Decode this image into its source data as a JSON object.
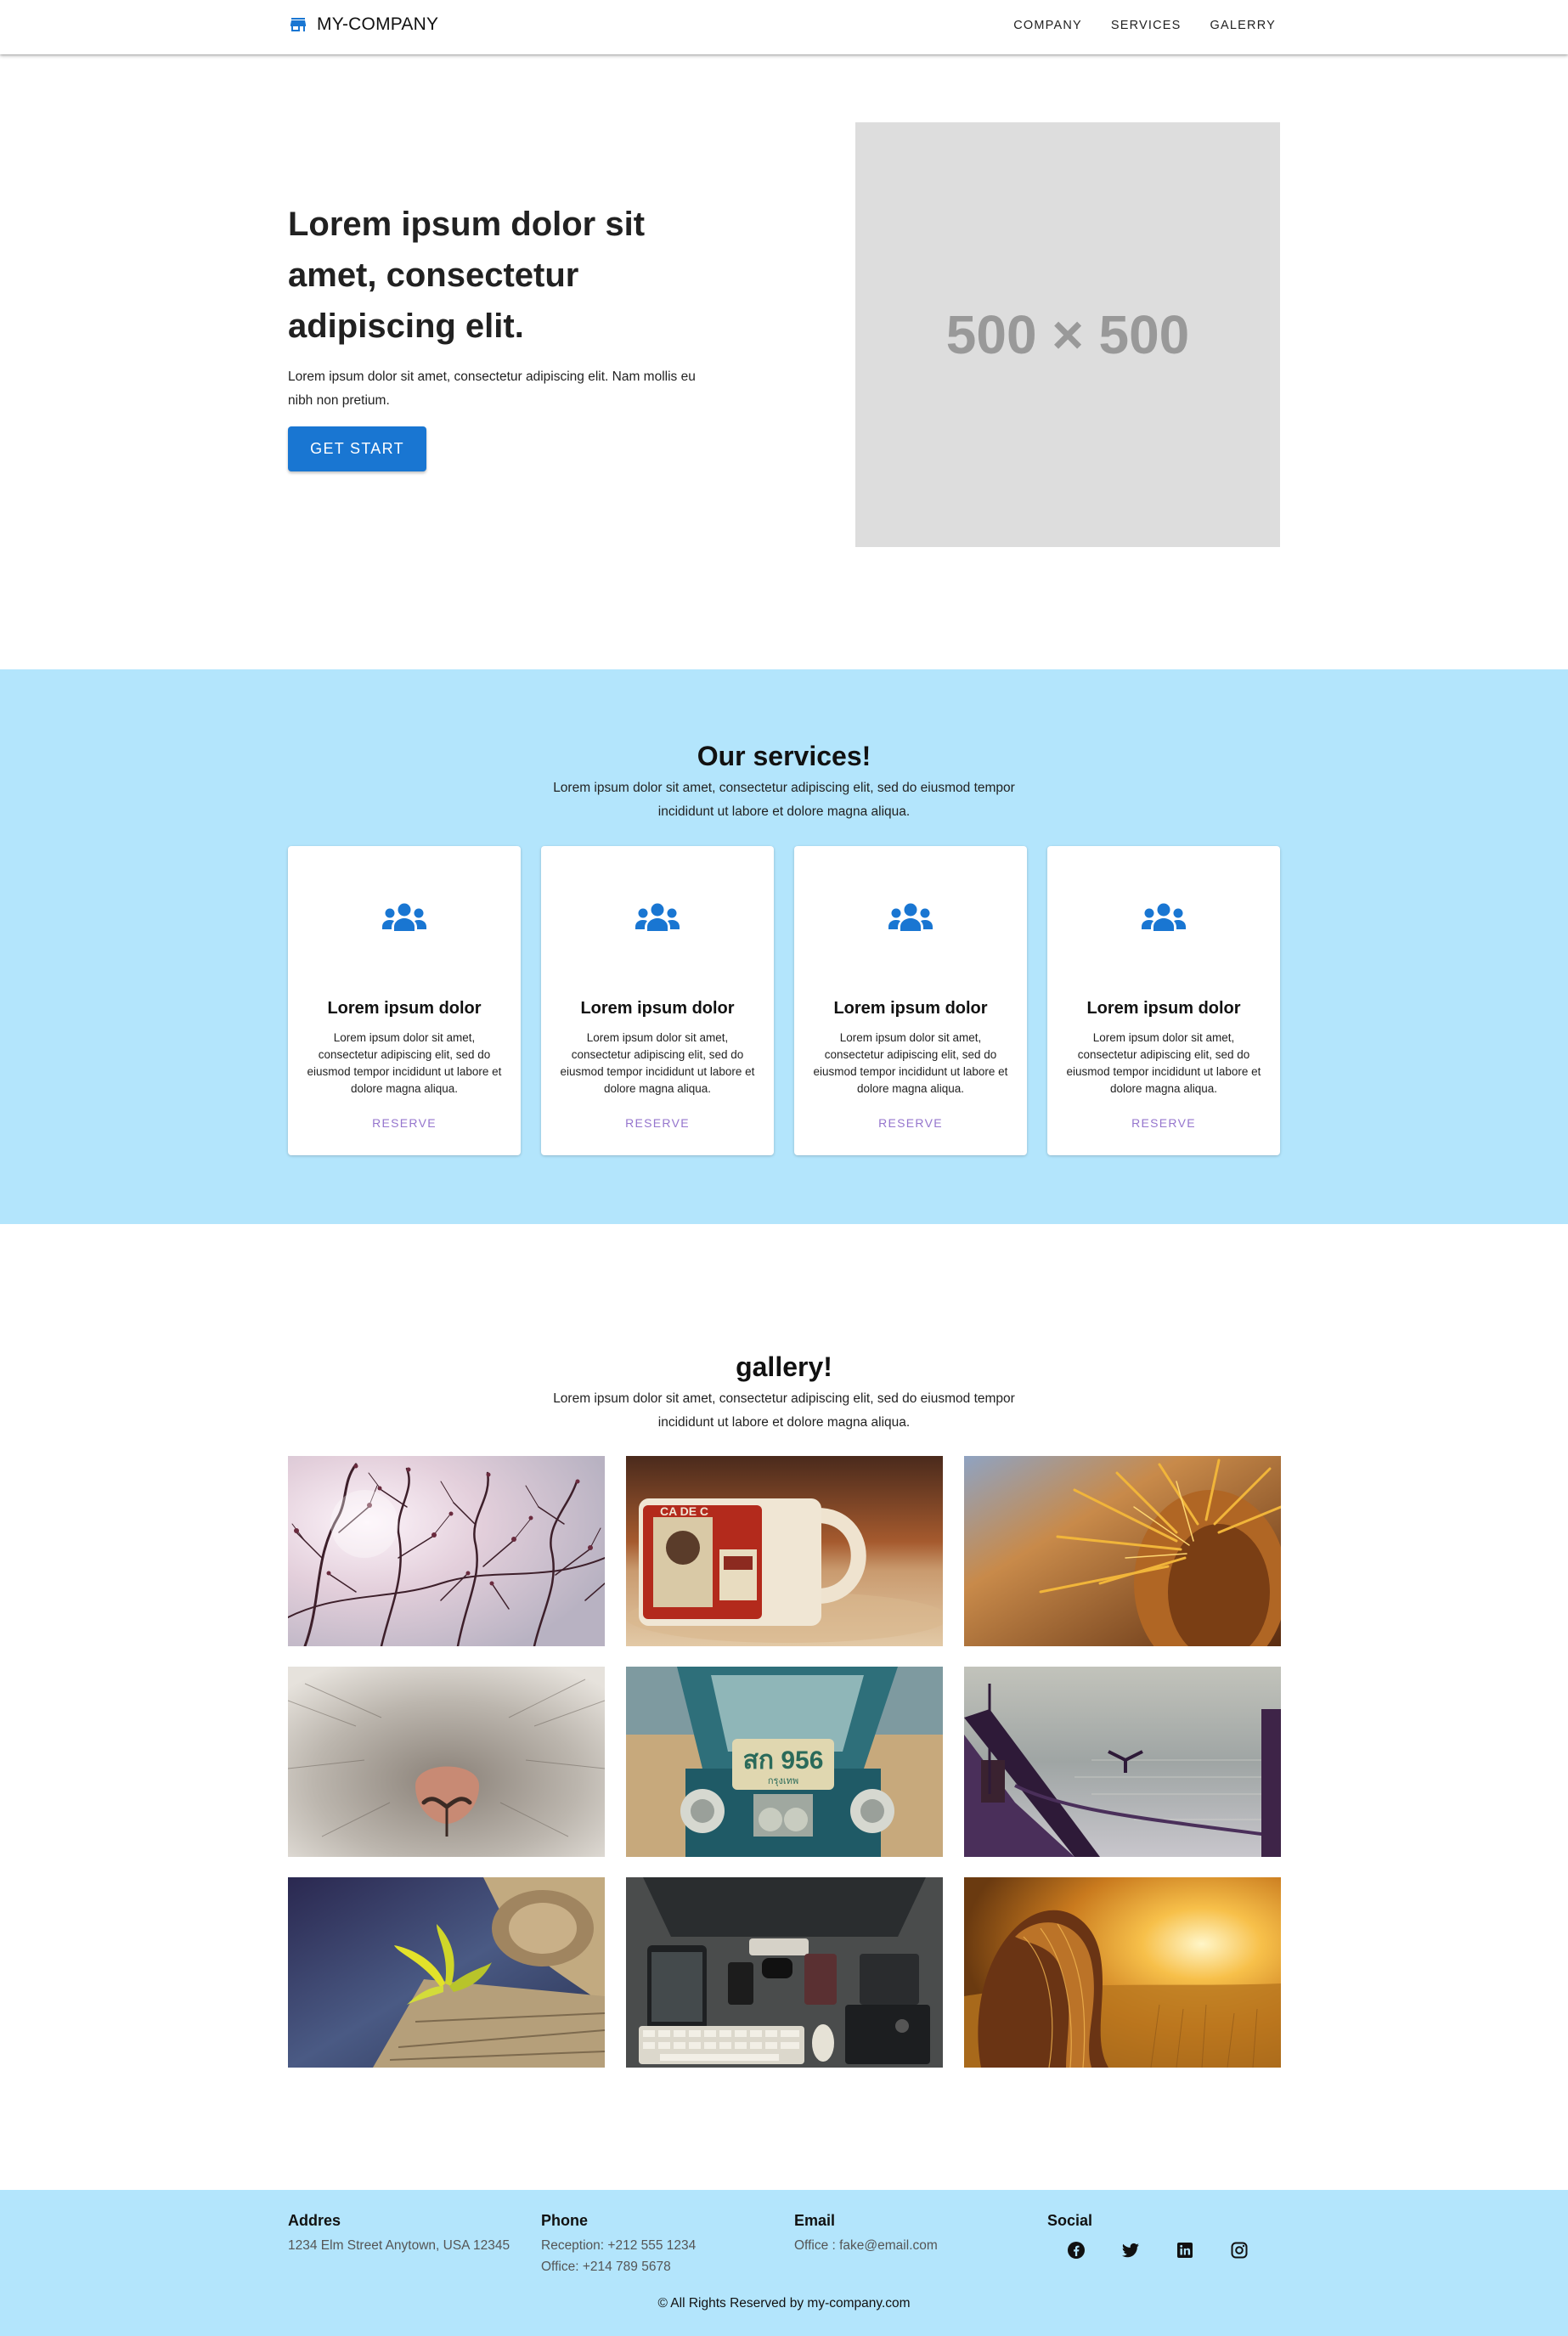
{
  "header": {
    "brand": "MY-COMPANY",
    "logo_icon": "store-icon",
    "nav": [
      "COMPANY",
      "SERVICES",
      "GALERRY"
    ]
  },
  "hero": {
    "title": "Lorem ipsum dolor sit amet, consectetur adipiscing elit.",
    "text": "Lorem ipsum dolor sit amet, consectetur adipiscing elit. Nam mollis eu nibh non pretium.",
    "button": "GET START",
    "image_placeholder": "500 × 500"
  },
  "services": {
    "title": "Our services!",
    "subtitle": "Lorem ipsum dolor sit amet, consectetur adipiscing elit, sed do eiusmod tempor incididunt ut labore et dolore magna aliqua.",
    "cards": [
      {
        "icon": "people-icon",
        "title": "Lorem ipsum dolor",
        "text": "Lorem ipsum dolor sit amet, consectetur adipiscing elit, sed do eiusmod tempor incididunt ut labore et dolore magna aliqua.",
        "action": "RESERVE"
      },
      {
        "icon": "people-icon",
        "title": "Lorem ipsum dolor",
        "text": "Lorem ipsum dolor sit amet, consectetur adipiscing elit, sed do eiusmod tempor incididunt ut labore et dolore magna aliqua.",
        "action": "RESERVE"
      },
      {
        "icon": "people-icon",
        "title": "Lorem ipsum dolor",
        "text": "Lorem ipsum dolor sit amet, consectetur adipiscing elit, sed do eiusmod tempor incididunt ut labore et dolore magna aliqua.",
        "action": "RESERVE"
      },
      {
        "icon": "people-icon",
        "title": "Lorem ipsum dolor",
        "text": "Lorem ipsum dolor sit amet, consectetur adipiscing elit, sed do eiusmod tempor incididunt ut labore et dolore magna aliqua.",
        "action": "RESERVE"
      }
    ]
  },
  "gallery": {
    "title": "gallery!",
    "subtitle": "Lorem ipsum dolor sit amet, consectetur adipiscing elit, sed do eiusmod tempor incididunt ut labore et dolore magna aliqua.",
    "photos": [
      "branches-photo",
      "mug-photo",
      "cactus-photo",
      "cat-nose-photo",
      "tuk-tuk-photo",
      "boat-bird-photo",
      "plant-wood-photo",
      "desk-gadgets-photo",
      "girl-sunset-photo"
    ]
  },
  "footer": {
    "address": {
      "title": "Addres",
      "lines": [
        "1234 Elm Street Anytown, USA 12345"
      ]
    },
    "phone": {
      "title": "Phone",
      "lines": [
        "Reception: +212 555 1234",
        "Office: +214 789 5678"
      ]
    },
    "email": {
      "title": "Email",
      "lines": [
        "Office : fake@email.com"
      ]
    },
    "social": {
      "title": "Social",
      "icons": [
        "facebook-icon",
        "twitter-icon",
        "linkedin-icon",
        "instagram-icon"
      ]
    },
    "copyright": "© All Rights Reserved by my-company.com"
  },
  "colors": {
    "primary": "#1976d2",
    "section_bg": "#b3e5fc",
    "reserve": "#9575cd",
    "placeholder_bg": "#dddddd",
    "placeholder_text": "#999999"
  }
}
